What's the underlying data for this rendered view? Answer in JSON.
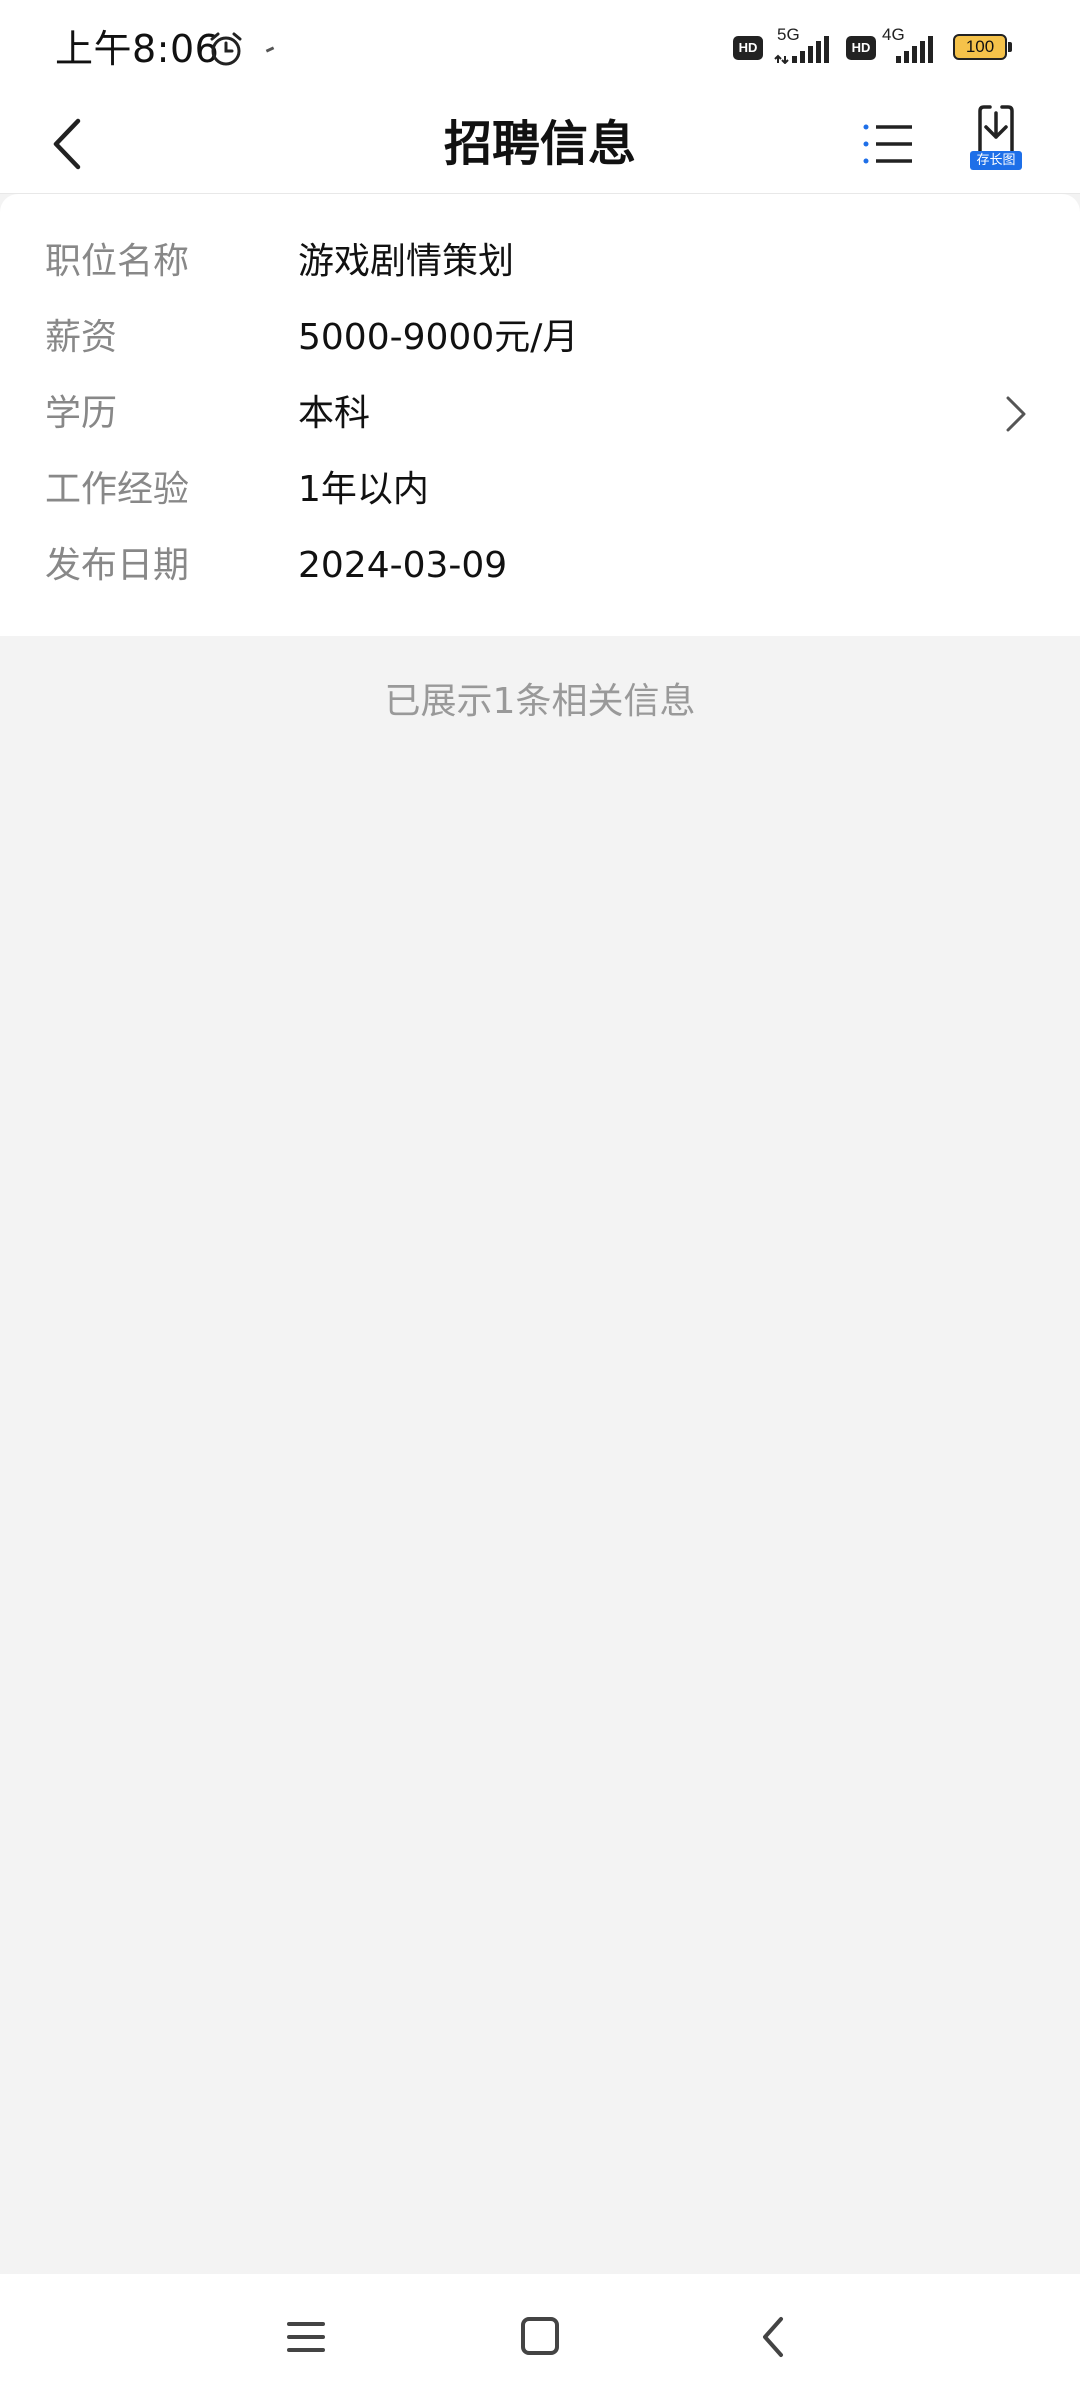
{
  "status_bar": {
    "time": "上午8:06",
    "hd_label": "HD",
    "network_1": "5G",
    "network_2": "4G",
    "battery": "100",
    "icons": [
      "alarm-icon",
      "signal-icon",
      "battery-icon"
    ]
  },
  "header": {
    "title": "招聘信息",
    "save_long_label": "存长图",
    "icons": [
      "back-arrow-icon",
      "list-menu-icon",
      "download-icon"
    ]
  },
  "job": {
    "rows": [
      {
        "label": "职位名称",
        "value": "游戏剧情策划"
      },
      {
        "label": "薪资",
        "value": "5000-9000元/月"
      },
      {
        "label": "学历",
        "value": "本科"
      },
      {
        "label": "工作经验",
        "value": "1年以内"
      },
      {
        "label": "发布日期",
        "value": "2024-03-09"
      }
    ]
  },
  "footer_note": "已展示1条相关信息",
  "nav_bar": {
    "icons": [
      "menu-icon",
      "home-icon",
      "back-icon"
    ]
  },
  "colors": {
    "accent": "#1e6fe8",
    "background": "#f3f3f3",
    "battery": "#f5c24a",
    "label_gray": "#888888"
  }
}
